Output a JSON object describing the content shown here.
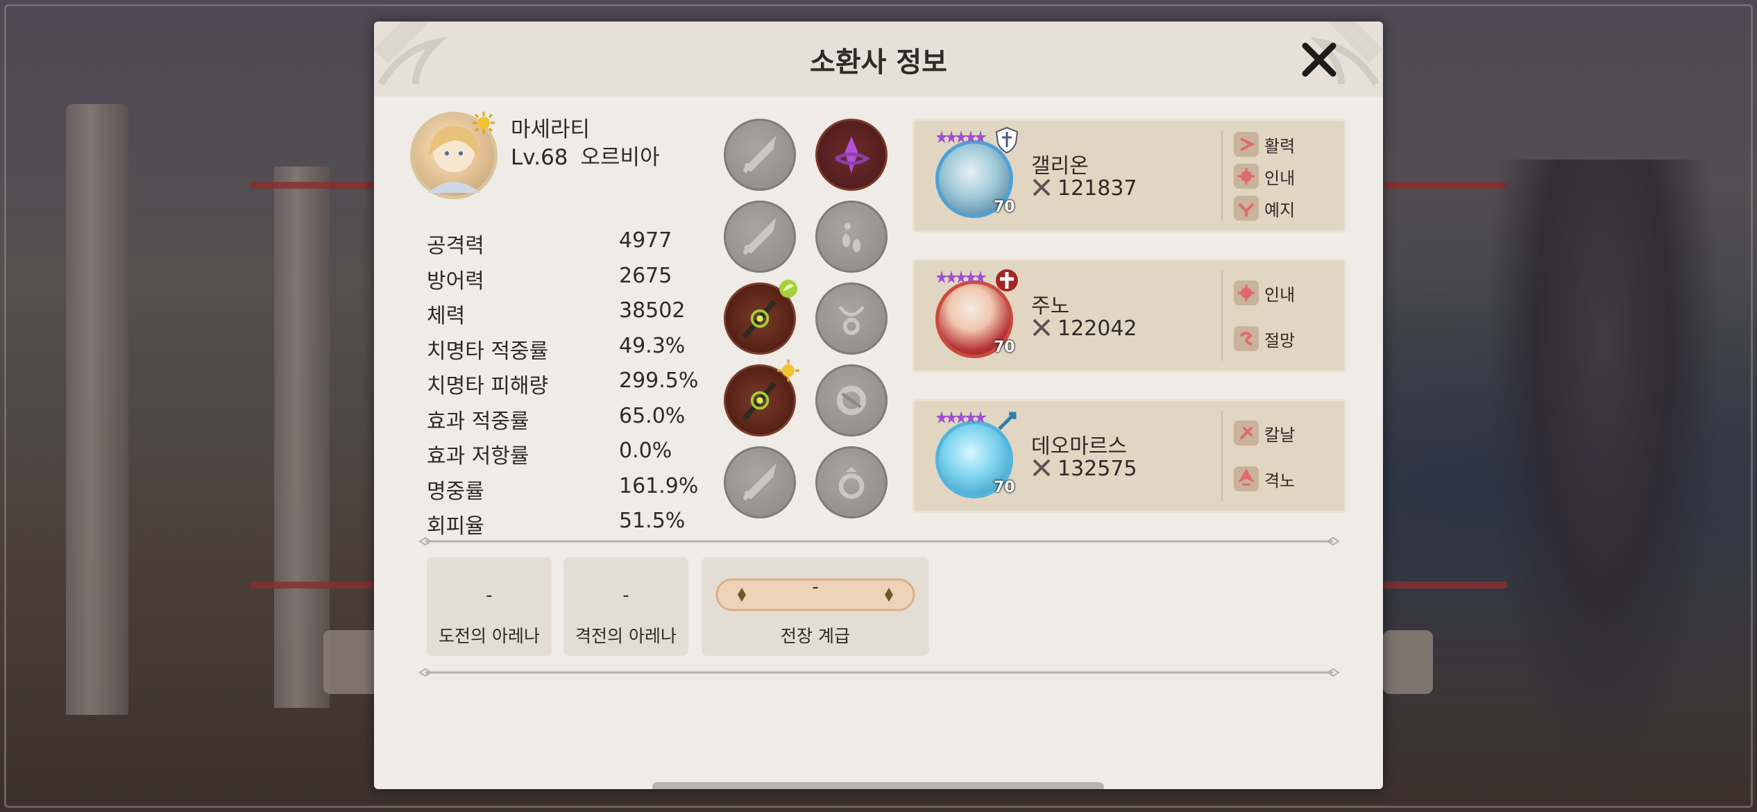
{
  "dialog": {
    "title": "소환사 정보",
    "close_icon": "close-icon"
  },
  "profile": {
    "name": "마세라티",
    "level": "Lv.68",
    "guild": "오르비아"
  },
  "stats": [
    {
      "label": "공격력",
      "value": "4977"
    },
    {
      "label": "방어력",
      "value": "2675"
    },
    {
      "label": "체력",
      "value": "38502"
    },
    {
      "label": "치명타 적중률",
      "value": "49.3%"
    },
    {
      "label": "치명타 피해량",
      "value": "299.5%"
    },
    {
      "label": "효과 적중률",
      "value": "65.0%"
    },
    {
      "label": "효과 저항률",
      "value": "0.0%"
    },
    {
      "label": "명중률",
      "value": "161.9%"
    },
    {
      "label": "회피율",
      "value": "51.5%"
    }
  ],
  "heroes": [
    {
      "name": "갤리온",
      "power": "121837",
      "level": "70",
      "portrait_color": "#5aa7c7",
      "runes": [
        {
          "label": "활력",
          "icon": "vitality-rune-icon"
        },
        {
          "label": "인내",
          "icon": "endurance-rune-icon"
        },
        {
          "label": "예지",
          "icon": "foresight-rune-icon"
        }
      ]
    },
    {
      "name": "주노",
      "power": "122042",
      "level": "70",
      "portrait_color": "#c94040",
      "runes": [
        {
          "label": "인내",
          "icon": "endurance-rune-icon"
        },
        {
          "label": "절망",
          "icon": "despair-rune-icon"
        }
      ]
    },
    {
      "name": "데오마르스",
      "power": "132575",
      "level": "70",
      "portrait_color": "#66c8e6",
      "runes": [
        {
          "label": "칼날",
          "icon": "blade-rune-icon"
        },
        {
          "label": "격노",
          "icon": "rage-rune-icon"
        }
      ]
    }
  ],
  "arena": {
    "challenge": {
      "value": "-",
      "label": "도전의 아레나"
    },
    "fierce": {
      "value": "-",
      "label": "격전의 아레나"
    },
    "battlefield": {
      "value": "-",
      "label": "전장 계급"
    }
  },
  "colors": {
    "dialog_bg": "#efebe6",
    "card_bg": "#e1d6c2",
    "rune_bg": "#c9b39c",
    "rune_mark": "#e06a6a"
  }
}
